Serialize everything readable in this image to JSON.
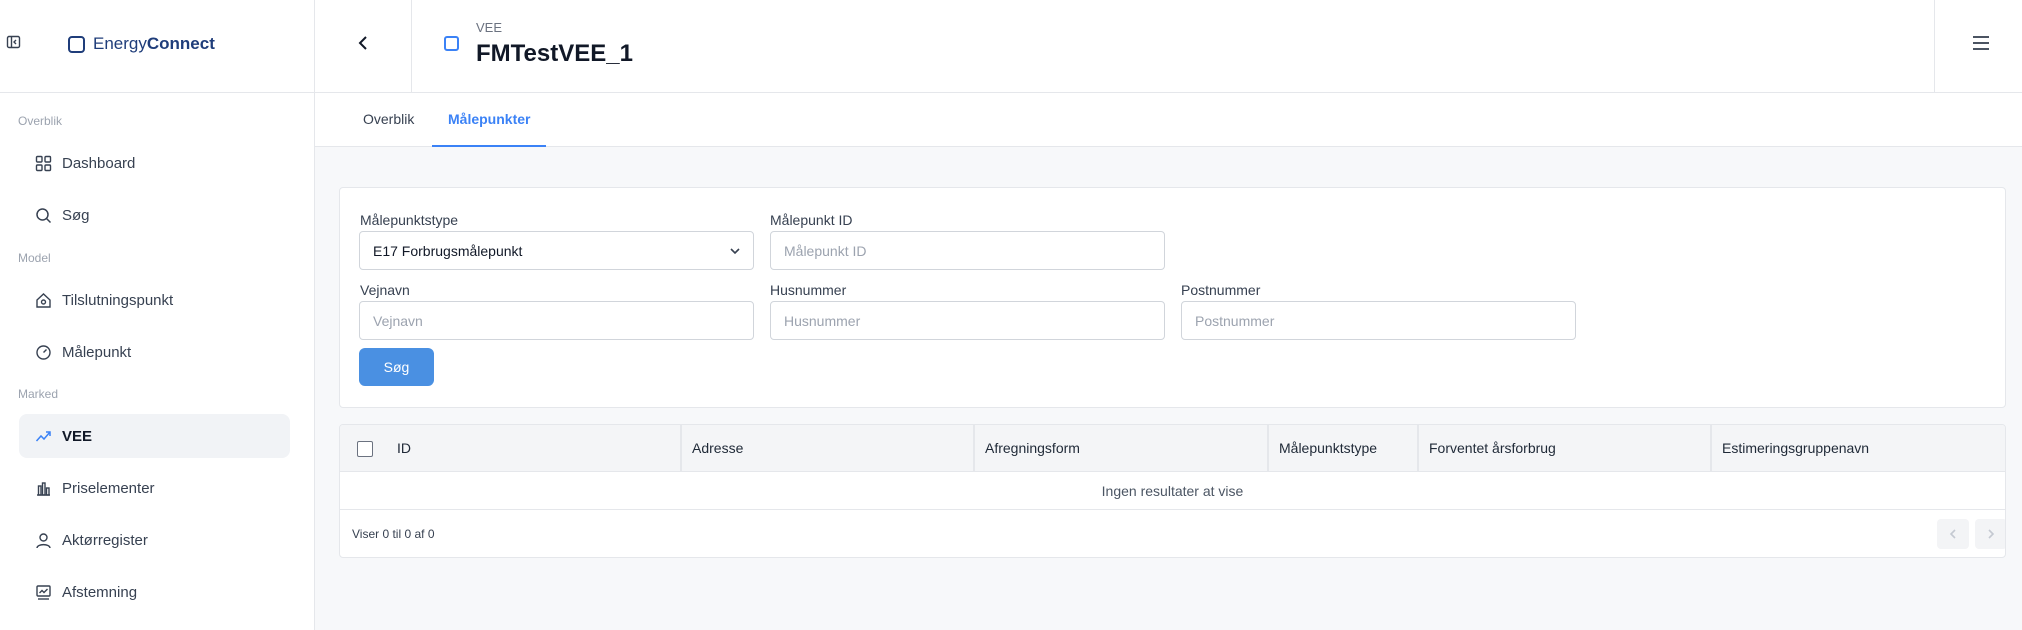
{
  "header": {
    "brand_light": "Energy",
    "brand_bold": "Connect",
    "breadcrumb": "VEE",
    "title": "FMTestVEE_1"
  },
  "sidebar": {
    "sections": [
      "Overblik",
      "Model",
      "Marked"
    ],
    "items": [
      {
        "label": "Dashboard",
        "icon": "dashboard-icon"
      },
      {
        "label": "Søg",
        "icon": "search-icon"
      },
      {
        "label": "Tilslutningspunkt",
        "icon": "house-icon"
      },
      {
        "label": "Målepunkt",
        "icon": "gauge-icon"
      },
      {
        "label": "VEE",
        "icon": "trend-icon",
        "active": true
      },
      {
        "label": "Priselementer",
        "icon": "price-chart-icon"
      },
      {
        "label": "Aktørregister",
        "icon": "person-icon"
      },
      {
        "label": "Afstemning",
        "icon": "reconcile-icon"
      }
    ]
  },
  "tabs": [
    {
      "label": "Overblik"
    },
    {
      "label": "Målepunkter",
      "active": true
    }
  ],
  "filters": {
    "type_label": "Målepunktstype",
    "type_value": "E17 Forbrugsmålepunkt",
    "id_label": "Målepunkt ID",
    "id_placeholder": "Målepunkt ID",
    "street_label": "Vejnavn",
    "street_placeholder": "Vejnavn",
    "house_label": "Husnummer",
    "house_placeholder": "Husnummer",
    "zip_label": "Postnummer",
    "zip_placeholder": "Postnummer",
    "search_button": "Søg"
  },
  "table": {
    "columns": [
      "ID",
      "Adresse",
      "Afregningsform",
      "Målepunktstype",
      "Forventet årsforbrug",
      "Estimeringsgruppenavn"
    ],
    "empty_text": "Ingen resultater at vise",
    "footer": "Viser 0 til 0 af 0"
  },
  "colors": {
    "accent": "#4a90e2",
    "brand": "#1f3d7a"
  }
}
